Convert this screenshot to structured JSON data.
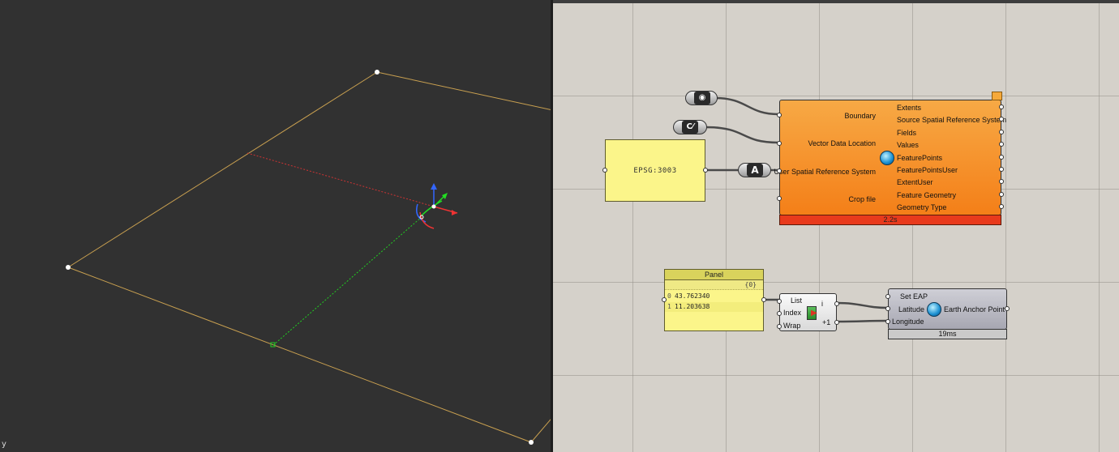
{
  "viewport": {
    "axis_label": "y"
  },
  "canvas": {
    "pill_boundary": {
      "icon": "geometry-hexagon-icon",
      "glyph": "◉"
    },
    "pill_file": {
      "icon": "file-path-icon",
      "glyph": "C⁄"
    },
    "pill_text": {
      "icon": "text-param-icon",
      "glyph": "A"
    },
    "epsg_panel": {
      "text": "EPSG:3003"
    },
    "vector_component": {
      "inputs": [
        "Boundary",
        "Vector Data Location",
        "User Spatial Reference System",
        "Crop file"
      ],
      "outputs": [
        "Extents",
        "Source Spatial Reference System",
        "Fields",
        "Values",
        "FeaturePoints",
        "FeaturePointsUser",
        "ExtentUser",
        "Feature Geometry",
        "Geometry Type"
      ],
      "timer": "2.2s",
      "icon": "globe-icon"
    },
    "list_panel": {
      "title": "Panel",
      "path": "{0}",
      "rows": [
        {
          "index": "0",
          "value": "43.762340"
        },
        {
          "index": "1",
          "value": "11.203638"
        }
      ]
    },
    "list_item_component": {
      "inputs": [
        "List",
        "Index",
        "Wrap"
      ],
      "outputs": [
        "i",
        "+1"
      ],
      "icon": "list-item-icon"
    },
    "eap_component": {
      "inputs": [
        "Set EAP",
        "Latitude",
        "Longitude"
      ],
      "output": "Earth Anchor Point",
      "timer": "19ms",
      "icon": "globe-icon"
    }
  },
  "colors": {
    "viewport_bg": "#313131",
    "canvas_bg": "#d5d1ca",
    "component_orange": "#f47f18",
    "panel_yellow": "#fbf58a",
    "timer_red": "#e83a1c"
  }
}
